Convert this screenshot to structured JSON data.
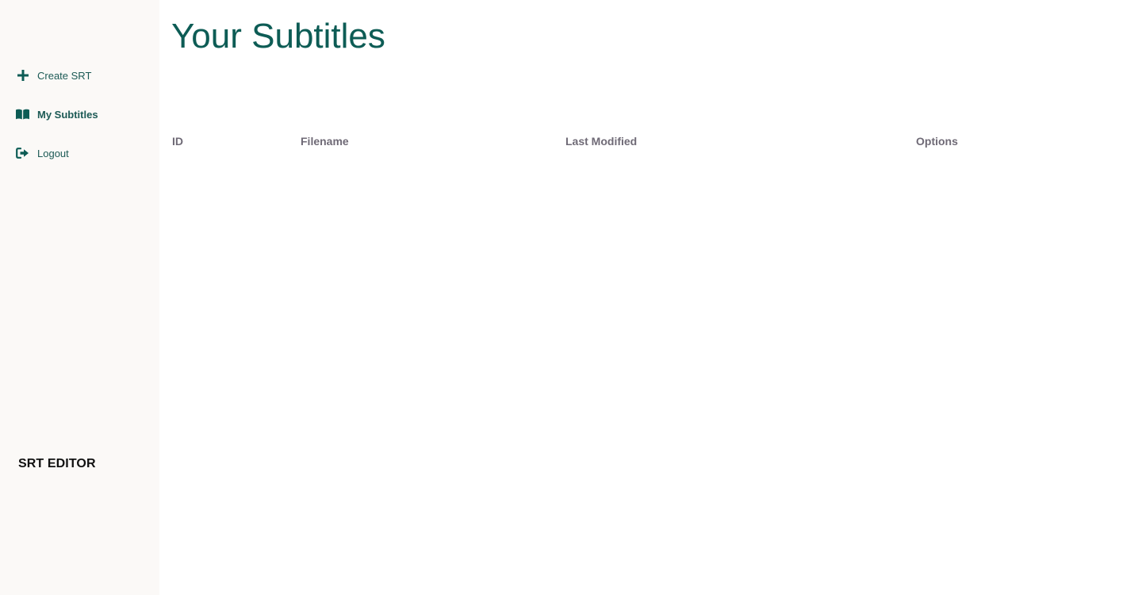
{
  "colors": {
    "accent": "#0d5c55",
    "sidebar_bg": "#fbf9f7",
    "header_text": "#6f6a76",
    "brand_text": "#111111"
  },
  "sidebar": {
    "items": [
      {
        "label": "Create SRT",
        "icon": "plus-icon",
        "active": false
      },
      {
        "label": "My Subtitles",
        "icon": "book-open-icon",
        "active": true
      },
      {
        "label": "Logout",
        "icon": "sign-out-icon",
        "active": false
      }
    ],
    "brand": "SRT EDITOR"
  },
  "main": {
    "title": "Your Subtitles",
    "table": {
      "columns": [
        "ID",
        "Filename",
        "Last Modified",
        "Options"
      ],
      "rows": []
    }
  }
}
